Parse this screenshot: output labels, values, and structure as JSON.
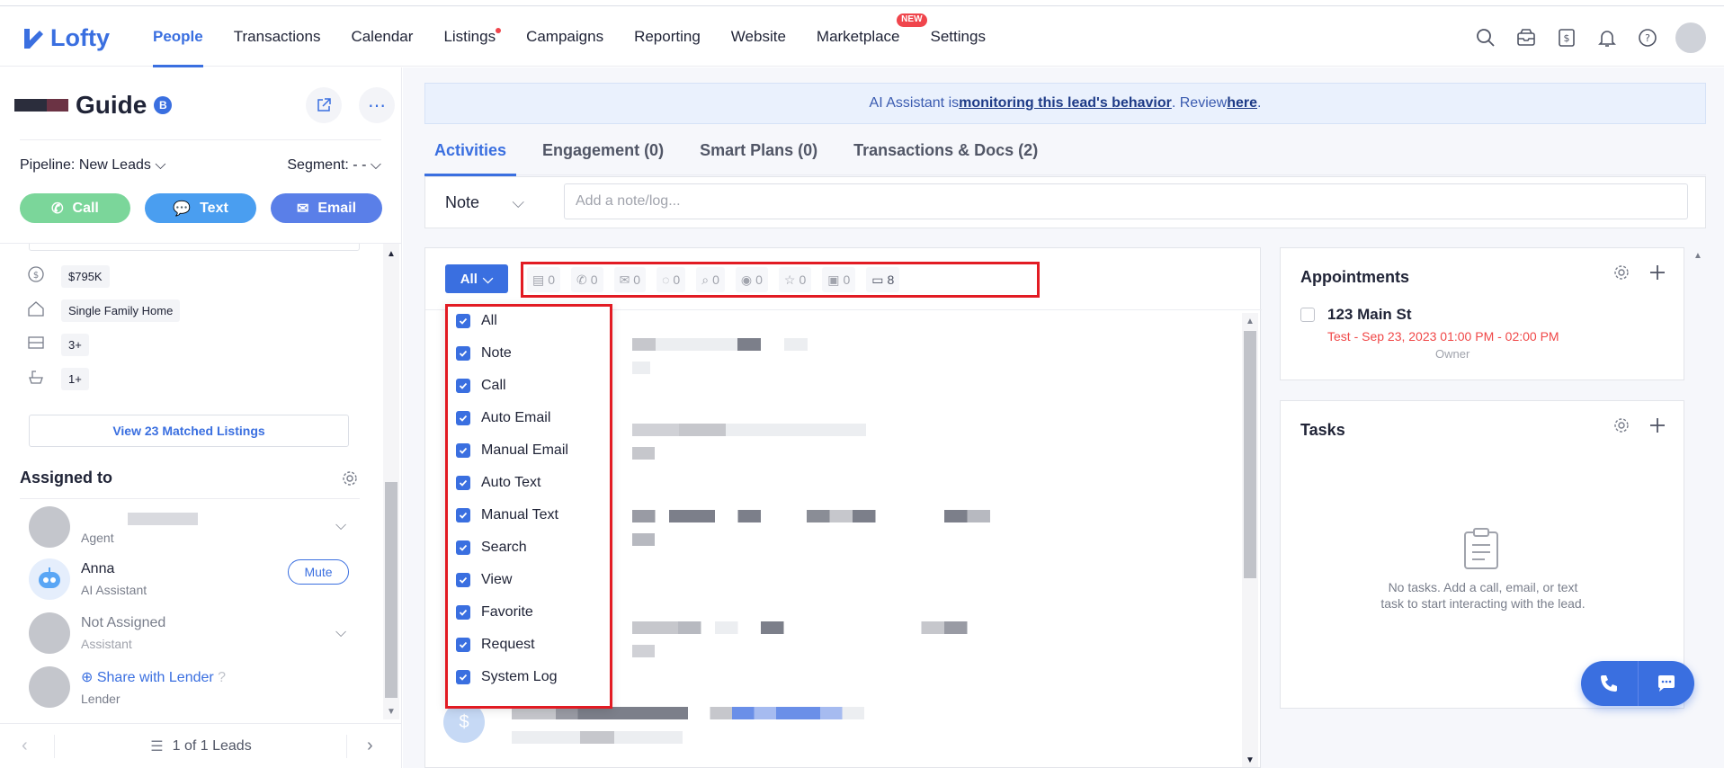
{
  "app": {
    "logo_text": "Lofty"
  },
  "nav": {
    "items": [
      {
        "label": "People",
        "active": true
      },
      {
        "label": "Transactions"
      },
      {
        "label": "Calendar"
      },
      {
        "label": "Listings",
        "dot": true
      },
      {
        "label": "Campaigns"
      },
      {
        "label": "Reporting"
      },
      {
        "label": "Website"
      },
      {
        "label": "Marketplace",
        "badge": "NEW"
      },
      {
        "label": "Settings"
      }
    ],
    "icons": [
      "search-icon",
      "inbox-icon",
      "dollar-icon",
      "bell-icon",
      "help-icon",
      "avatar"
    ]
  },
  "lead": {
    "name": "Guide",
    "badge": "B",
    "pipeline": "Pipeline: New Leads",
    "segment": "Segment: - -",
    "call": "Call",
    "text": "Text",
    "email": "Email"
  },
  "props": {
    "price": "$795K",
    "type": "Single Family Home",
    "beds": "3+",
    "baths": "1+",
    "matched": "View 23 Matched Listings"
  },
  "assigned": {
    "title": "Assigned to",
    "agent_role": "Agent",
    "ai_name": "Anna",
    "ai_role": "AI Assistant",
    "mute": "Mute",
    "assistant_name": "Not Assigned",
    "assistant_role": "Assistant",
    "lender_link": "Share with Lender",
    "lender_role": "Lender"
  },
  "footer": {
    "pager": "1 of 1 Leads"
  },
  "banner": {
    "prefix": "AI Assistant is ",
    "link": "monitoring this lead's behavior",
    "mid": ". Review ",
    "here": "here",
    "suffix": "."
  },
  "tabs": [
    {
      "label": "Activities",
      "active": true
    },
    {
      "label": "Engagement (0)"
    },
    {
      "label": "Smart Plans (0)"
    },
    {
      "label": "Transactions & Docs (2)"
    }
  ],
  "note": {
    "type": "Note",
    "placeholder": "Add a note/log..."
  },
  "activity": {
    "all_label": "All",
    "filters": [
      {
        "icon": "note-icon",
        "count": "0"
      },
      {
        "icon": "call-icon",
        "count": "0"
      },
      {
        "icon": "email-icon",
        "count": "0"
      },
      {
        "icon": "text-icon",
        "count": "0"
      },
      {
        "icon": "search-icon",
        "count": "0"
      },
      {
        "icon": "view-icon",
        "count": "0"
      },
      {
        "icon": "favorite-icon",
        "count": "0"
      },
      {
        "icon": "request-icon",
        "count": "0"
      },
      {
        "icon": "system-log-icon",
        "count": "8"
      }
    ],
    "dropdown": [
      "All",
      "Note",
      "Call",
      "Auto Email",
      "Manual Email",
      "Auto Text",
      "Manual Text",
      "Search",
      "View",
      "Favorite",
      "Request",
      "System Log"
    ]
  },
  "appointments": {
    "title": "Appointments",
    "item_title": "123 Main St",
    "item_time": "Test - Sep 23, 2023 01:00 PM - 02:00 PM",
    "item_owner": "Owner"
  },
  "tasks": {
    "title": "Tasks",
    "empty": "No tasks. Add a call, email, or text task to start interacting with the lead."
  },
  "colors": {
    "accent": "#3a6fe0",
    "call": "#7bd69a",
    "text": "#4a9ef0",
    "email": "#5a7fe8",
    "highlight": "#e21b23"
  }
}
